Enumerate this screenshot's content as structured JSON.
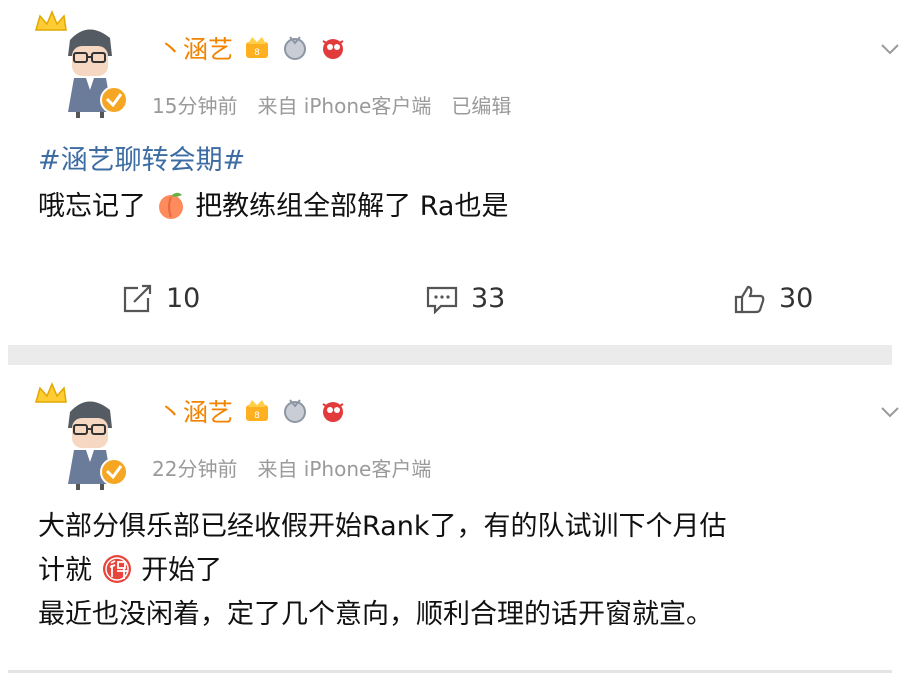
{
  "posts": [
    {
      "username": "丶涵艺",
      "time": "15分钟前",
      "source": "来自 iPhone客户端",
      "edited": "已编辑",
      "hashtag": "#涵艺聊转会期#",
      "text_before_emoji": "哦忘记了",
      "text_after_emoji": "把教练组全部解了  Ra也是",
      "inline_emoji": "peach-emoji",
      "actions": {
        "repost": "10",
        "comment": "33",
        "like": "30"
      }
    },
    {
      "username": "丶涵艺",
      "time": "22分钟前",
      "source": "来自 iPhone客户端",
      "line1": "大部分俱乐部已经收假开始Rank了，有的队试训下个月估",
      "line2_before_icon": "计就",
      "line2_after_icon": "开始了",
      "inline_icon": "de-character-icon",
      "line3": "最近也没闲着，定了几个意向，顺利合理的话开窗就宣。"
    }
  ],
  "colors": {
    "username": "#f08300",
    "meta": "#9a9a9a",
    "hashtag": "#3d6ca3",
    "separator": "#ebebeb",
    "verified": "#f5a623"
  }
}
